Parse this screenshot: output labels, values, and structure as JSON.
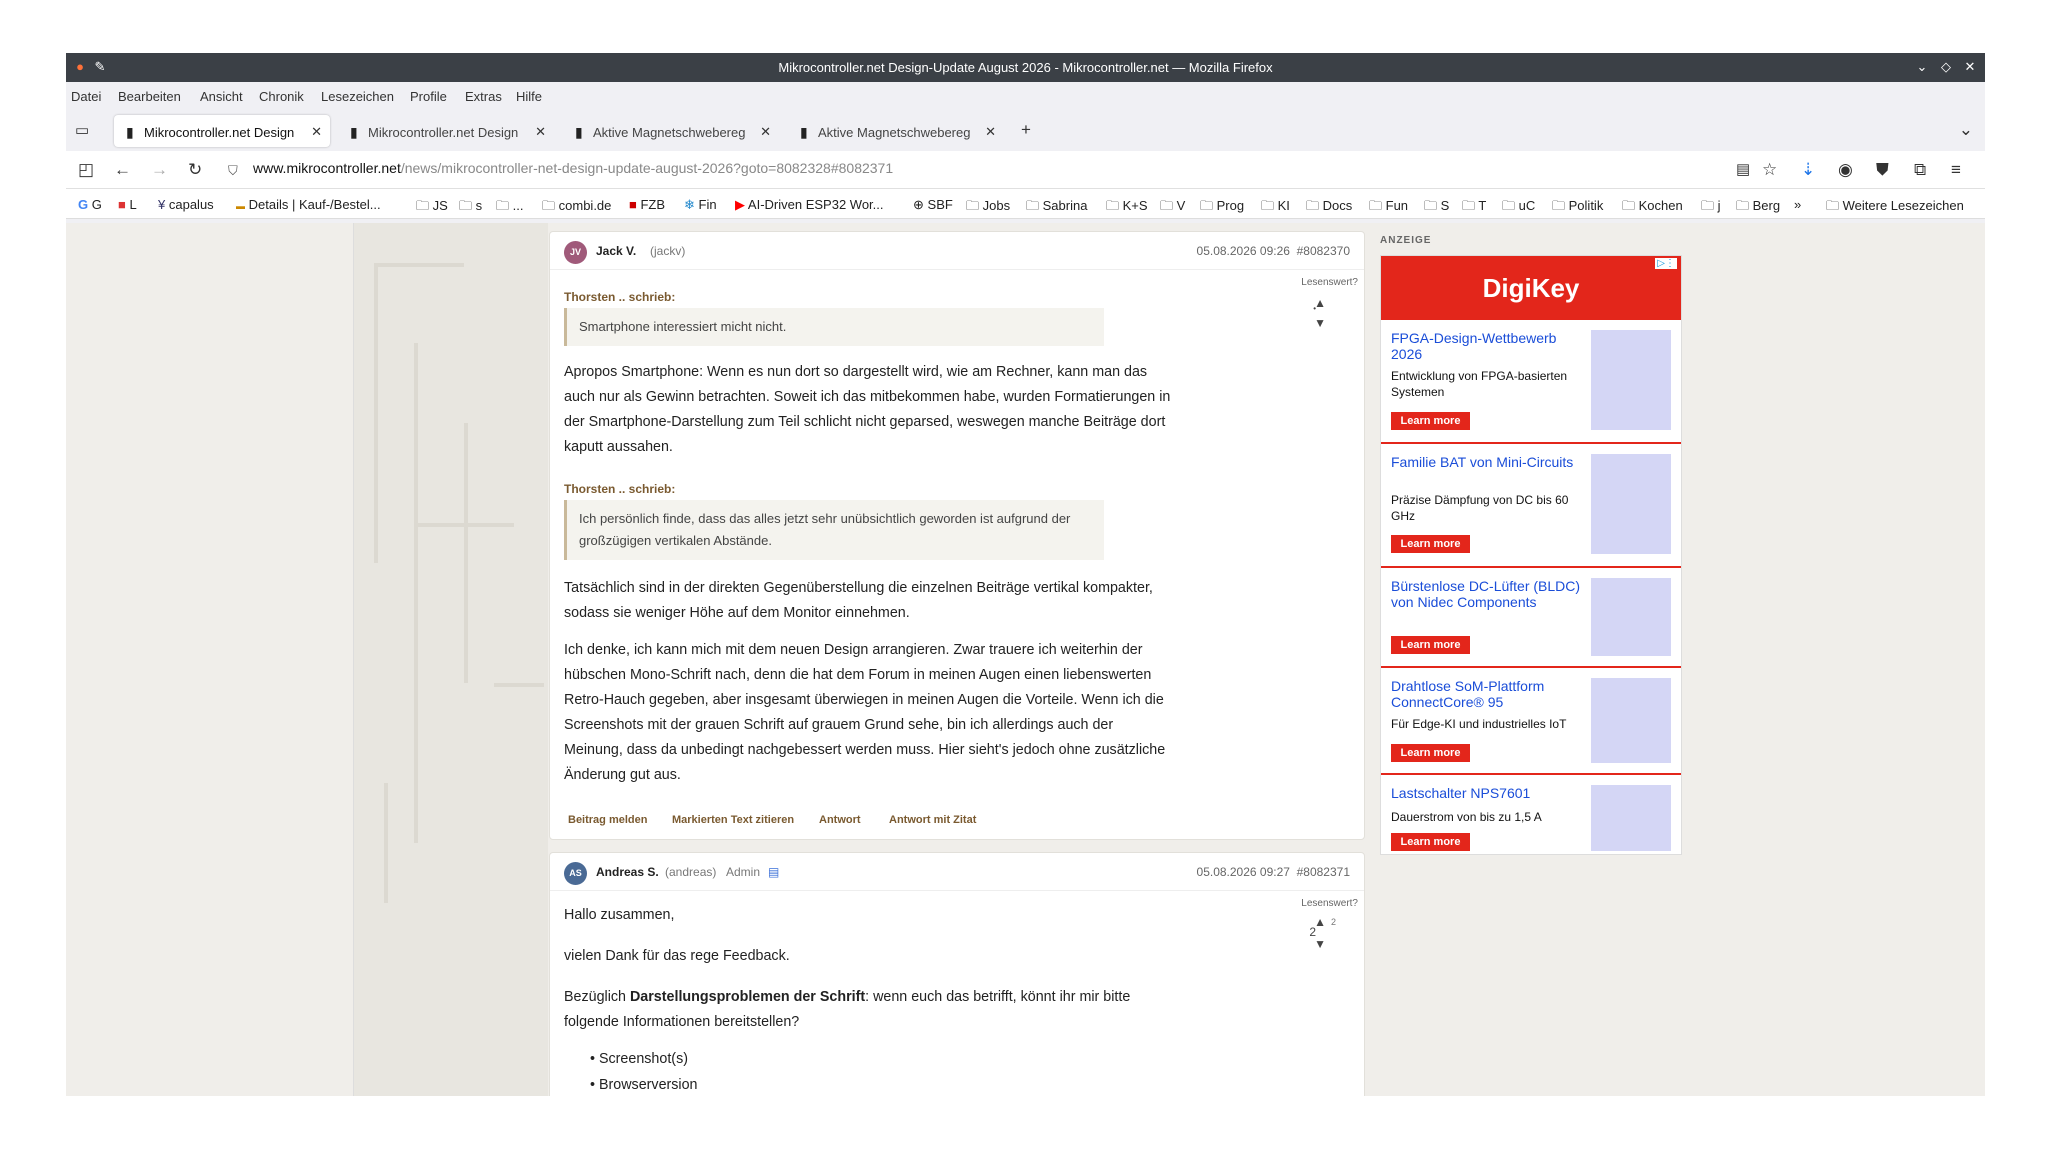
{
  "window": {
    "title": "Mikrocontroller.net Design-Update August 2026 - Mikrocontroller.net — Mozilla Firefox"
  },
  "menu": [
    "Datei",
    "Bearbeiten",
    "Ansicht",
    "Chronik",
    "Lesezeichen",
    "Profile",
    "Extras",
    "Hilfe"
  ],
  "tabs": [
    {
      "label": "Mikrocontroller.net Design"
    },
    {
      "label": "Mikrocontroller.net Design"
    },
    {
      "label": "Aktive Magnetschwebereg"
    },
    {
      "label": "Aktive Magnetschwebereg"
    }
  ],
  "url": {
    "domain": "www.mikrocontroller.net",
    "path": "/news/mikrocontroller-net-design-update-august-2026?goto=8082328#8082371",
    "prefix": "www."
  },
  "bookmarks": [
    "G",
    "L",
    "capalus",
    "Details | Kauf-/Bestel...",
    "JS",
    "s",
    "...",
    "combi.de",
    "FZB",
    "Fin",
    "AI-Driven ESP32 Wor...",
    "SBF",
    "Jobs",
    "Sabrina",
    "K+S",
    "V",
    "Prog",
    "KI",
    "Docs",
    "Fun",
    "S",
    "T",
    "uC",
    "Politik",
    "Kochen",
    "j",
    "Berg",
    "Weitere Lesezeichen"
  ],
  "post1": {
    "avatar": "JV",
    "name": "Jack V.",
    "user": "(jackv)",
    "date": "05.08.2026 09:26",
    "id": "#8082370",
    "lesenswert": "Lesenswert?",
    "q1_author": "Thorsten .. schrieb:",
    "q1": "Smartphone interessiert micht nicht.",
    "p1": "Apropos Smartphone: Wenn es nun dort so dargestellt wird, wie am Rechner, kann man das auch nur als Gewinn betrachten. Soweit ich das mitbekommen habe, wurden Formatierungen in der Smartphone-Darstellung zum Teil schlicht nicht geparsed, weswegen manche Beiträge dort kaputt aussahen.",
    "q2_author": "Thorsten .. schrieb:",
    "q2": "Ich persönlich finde, dass das alles jetzt sehr unübsichtlich geworden ist aufgrund der großzügigen vertikalen Abstände.",
    "p2": "Tatsächlich sind in der direkten Gegenüberstellung die einzelnen Beiträge vertikal kompakter, sodass sie weniger Höhe auf dem Monitor einnehmen.",
    "p3": "Ich denke, ich kann mich mit dem neuen Design arrangieren. Zwar trauere ich weiterhin der hübschen Mono-Schrift nach, denn die hat dem Forum in meinen Augen einen liebenswerten Retro-Hauch gegeben, aber insgesamt überwiegen in meinen Augen die Vorteile. Wenn ich die Screenshots mit der grauen Schrift auf grauem Grund sehe, bin ich allerdings auch der Meinung, dass da unbedingt nachgebessert werden muss. Hier sieht's jedoch ohne zusätzliche Änderung gut aus.",
    "actions": [
      "Beitrag melden",
      "Markierten Text zitieren",
      "Antwort",
      "Antwort mit Zitat"
    ]
  },
  "post2": {
    "avatar": "AS",
    "name": "Andreas S.",
    "user": "(andreas)",
    "role": "Admin",
    "date": "05.08.2026 09:27",
    "id": "#8082371",
    "lesenswert": "Lesenswert?",
    "score": "2",
    "up": "2",
    "greeting": "Hallo zusammen,",
    "thanks": "vielen Dank für das rege Feedback.",
    "p_pre": "Bezüglich ",
    "p_bold": "Darstellungsproblemen der Schrift",
    "p_post": ": wenn euch das betrifft, könnt ihr mir bitte folgende Informationen bereitstellen?",
    "list": [
      "Screenshot(s)",
      "Browserversion"
    ]
  },
  "ad": {
    "label": "ANZEIGE",
    "brand": "DigiKey",
    "cta": "Learn more",
    "items": [
      {
        "title": "FPGA-Design-Wettbewerb 2026",
        "desc": "Entwicklung von FPGA-basierten Systemen"
      },
      {
        "title": "Familie BAT von Mini-Circuits",
        "desc": "Präzise Dämpfung von DC bis 60 GHz"
      },
      {
        "title": "Bürstenlose DC-Lüfter (BLDC) von Nidec Components",
        "desc": ""
      },
      {
        "title": "Drahtlose SoM-Plattform ConnectCore® 95",
        "desc": "Für Edge-KI und industrielles IoT"
      },
      {
        "title": "Lastschalter NPS7601",
        "desc": "Dauerstrom von bis zu 1,5 A"
      }
    ]
  }
}
